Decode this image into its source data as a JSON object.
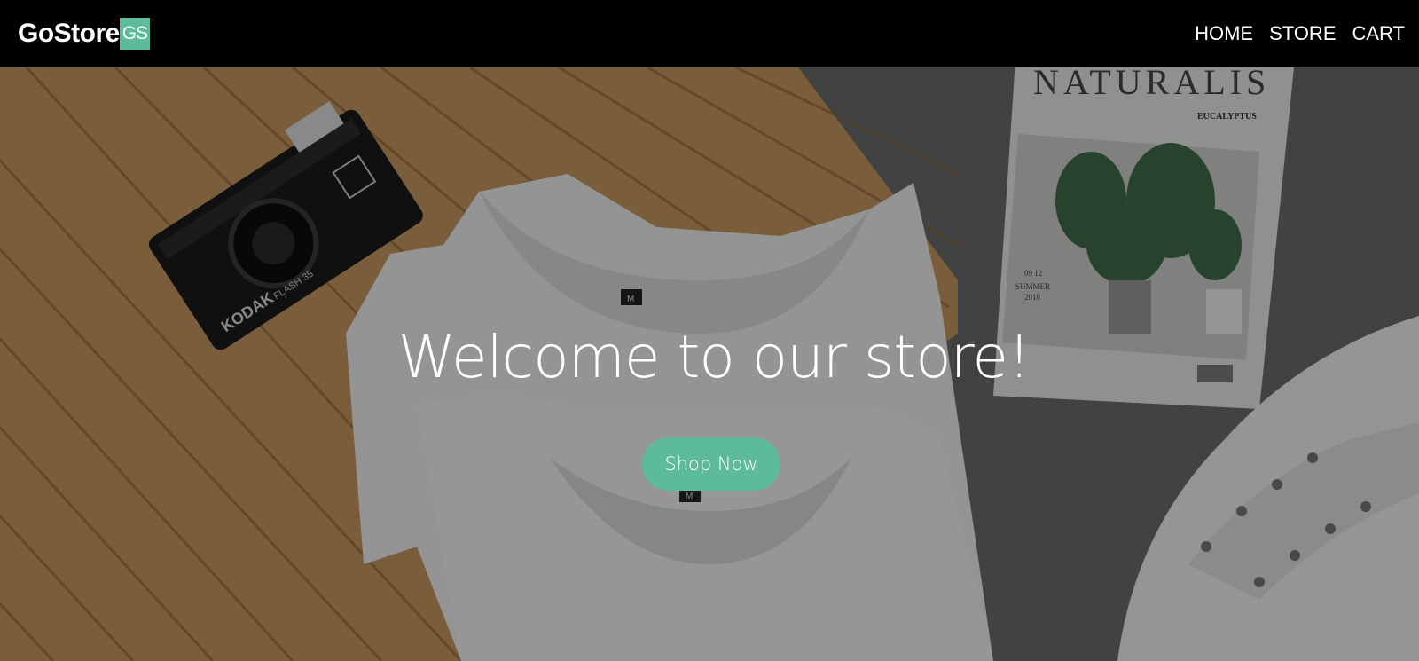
{
  "navbar": {
    "brand_text": "GoStore",
    "brand_badge": "GS",
    "links": [
      {
        "label": "HOME"
      },
      {
        "label": "STORE"
      },
      {
        "label": "CART"
      }
    ]
  },
  "hero": {
    "title": "Welcome to our store!",
    "cta_label": "Shop Now",
    "background_image": {
      "camera_brand": "KODAK",
      "camera_model": "FLASH 35",
      "magazine_title": "NATURALIS",
      "magazine_heading": "EUCALYPTUS",
      "magazine_date": "09 12 SUMMER 2018",
      "tshirt_size_label": "M"
    }
  },
  "colors": {
    "accent": "#5dbb9c",
    "navbar_bg": "#000000",
    "text": "#ffffff"
  }
}
